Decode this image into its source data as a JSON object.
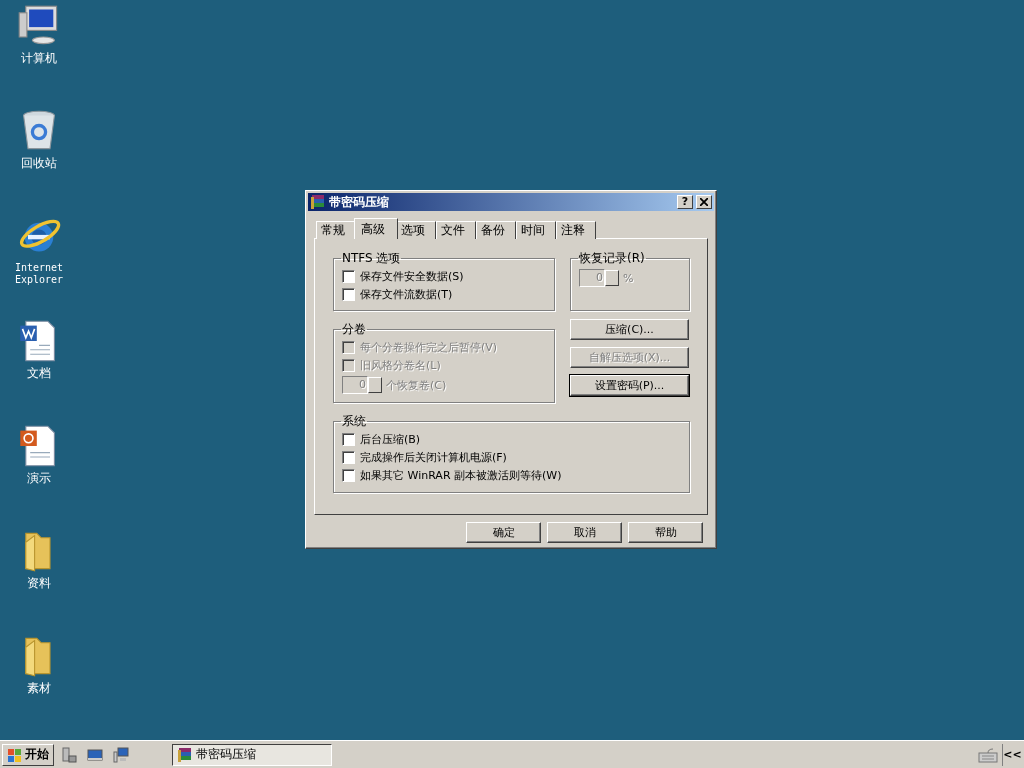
{
  "desktop_icons": [
    {
      "label": "计算机",
      "kind": "computer"
    },
    {
      "label": "回收站",
      "kind": "recycle-bin"
    },
    {
      "label": "Internet Explorer",
      "kind": "browser"
    },
    {
      "label": "文档",
      "kind": "word-document"
    },
    {
      "label": "演示",
      "kind": "presentation"
    },
    {
      "label": "资料",
      "kind": "folder"
    },
    {
      "label": "素材",
      "kind": "folder"
    }
  ],
  "dialog": {
    "title": "带密码压缩",
    "help_button": "?",
    "tabs": [
      {
        "label": "常规",
        "selected": false
      },
      {
        "label": "高级",
        "selected": true
      },
      {
        "label": "选项",
        "selected": false
      },
      {
        "label": "文件",
        "selected": false
      },
      {
        "label": "备份",
        "selected": false
      },
      {
        "label": "时间",
        "selected": false
      },
      {
        "label": "注释",
        "selected": false
      }
    ],
    "ntfs_group": {
      "title": "NTFS 选项",
      "options": [
        {
          "label": "保存文件安全数据(S)",
          "checked": false,
          "disabled": false
        },
        {
          "label": "保存文件流数据(T)",
          "checked": false,
          "disabled": false
        }
      ]
    },
    "recovery_record": {
      "title": "恢复记录(R)",
      "value": "0",
      "unit": "%",
      "disabled": true
    },
    "volumes_group": {
      "title": "分卷",
      "options": [
        {
          "label": "每个分卷操作完之后暂停(V)",
          "checked": false,
          "disabled": true
        },
        {
          "label": "旧风格分卷名(L)",
          "checked": false,
          "disabled": true
        }
      ],
      "recovery_volumes": {
        "value": "0",
        "label": "个恢复卷(C)",
        "disabled": true
      }
    },
    "side_buttons": [
      {
        "label": "压缩(C)...",
        "disabled": false,
        "default": false
      },
      {
        "label": "自解压选项(X)...",
        "disabled": true,
        "default": false
      },
      {
        "label": "设置密码(P)...",
        "disabled": false,
        "default": true
      }
    ],
    "system_group": {
      "title": "系统",
      "options": [
        {
          "label": "后台压缩(B)",
          "checked": false,
          "disabled": false
        },
        {
          "label": "完成操作后关闭计算机电源(F)",
          "checked": false,
          "disabled": false
        },
        {
          "label": "如果其它 WinRAR 副本被激活则等待(W)",
          "checked": false,
          "disabled": false
        }
      ]
    },
    "footer_buttons": [
      "确定",
      "取消",
      "帮助"
    ]
  },
  "taskbar": {
    "start": "开始",
    "quick_launch": [
      {
        "kind": "server"
      },
      {
        "kind": "desktop"
      },
      {
        "kind": "network"
      }
    ],
    "tasks": [
      {
        "label": "带密码压缩",
        "selected": true
      }
    ],
    "tray_toggle": "<<"
  }
}
